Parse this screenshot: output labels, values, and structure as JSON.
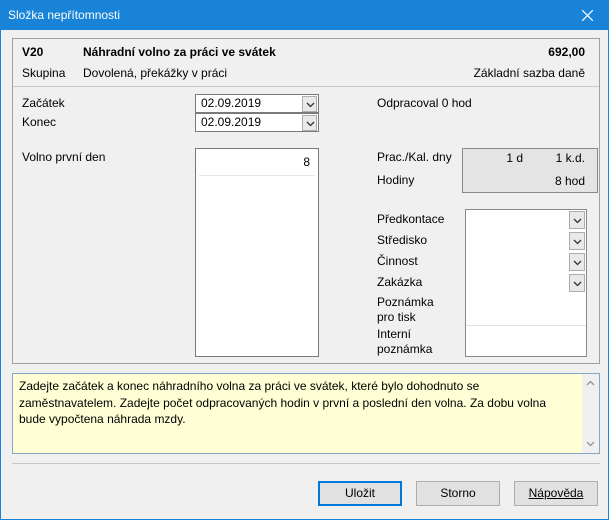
{
  "window": {
    "title": "Složka nepřítomnosti"
  },
  "header": {
    "code": "V20",
    "name": "Náhradní volno za práci ve svátek",
    "amount": "692,00",
    "group_label": "Skupina",
    "group_value": "Dovolená, překážky v práci",
    "tax_base": "Základní sazba daně"
  },
  "dates": {
    "start_label": "Začátek",
    "start_value": "02.09.2019",
    "end_label": "Konec",
    "end_value": "02.09.2019"
  },
  "worked": {
    "label": "Odpracoval 0 hod"
  },
  "first_day": {
    "label": "Volno první den",
    "value": "8"
  },
  "summary": {
    "days_label": "Prac./Kal. dny",
    "work_days": "1 d",
    "cal_days": "1 k.d.",
    "hours_label": "Hodiny",
    "hours_value": "8 hod"
  },
  "extra": {
    "predkontace": "Předkontace",
    "stredisko": "Středisko",
    "cinnost": "Činnost",
    "zakazka": "Zakázka",
    "poznamka_1": "Poznámka",
    "poznamka_2": "pro tisk",
    "interni_1": "Interní",
    "interni_2": "poznámka"
  },
  "hint": {
    "text": "Zadejte začátek a konec náhradního volna za práci ve svátek, které bylo dohodnuto se zaměstnavatelem. Zadejte počet odpracovaných hodin v první a poslední den volna. Za dobu volna bude vypočtena náhrada mzdy."
  },
  "buttons": {
    "ok": "Uložit",
    "cancel": "Storno",
    "help": "Nápověda"
  }
}
